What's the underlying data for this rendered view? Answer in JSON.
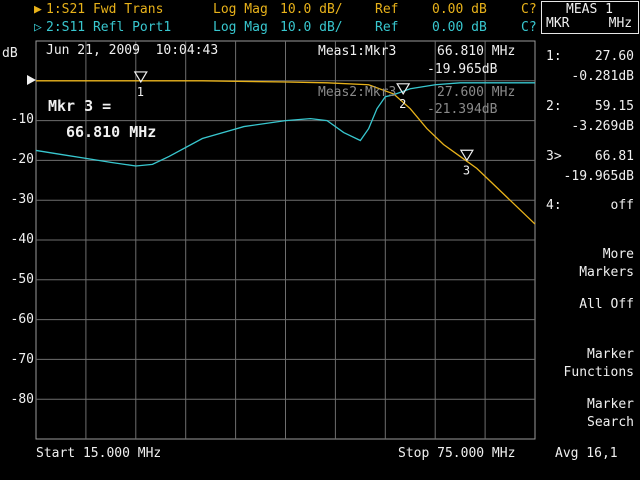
{
  "traces": [
    {
      "indicator": "▶",
      "label": "1:S21 Fwd Trans",
      "format": "Log Mag",
      "scale": "10.0 dB/",
      "ref_label": "Ref",
      "ref_value": "0.00 dB",
      "corr": "C?",
      "color": "#e8b21a"
    },
    {
      "indicator": "▷",
      "label": "2:S11 Refl Port1",
      "format": "Log Mag",
      "scale": "10.0 dB/",
      "ref_label": "Ref",
      "ref_value": "0.00 dB",
      "corr": "C?",
      "color": "#38c7cf"
    }
  ],
  "plot": {
    "unit": "dB",
    "timestamp": "Jun 21, 2009  10:04:43",
    "ytick_labels": [
      "-10",
      "-20",
      "-30",
      "-40",
      "-50",
      "-60",
      "-70",
      "-80"
    ],
    "start": "Start 15.000 MHz",
    "stop": "Stop 75.000 MHz",
    "avg": "Avg 16,1",
    "marker_callout_line1": "Mkr 3 =",
    "marker_callout_line2": "66.810 MHz",
    "meas1_label": "Meas1:Mkr3",
    "meas1_freq": "66.810 MHz",
    "meas1_val": "-19.965dB",
    "meas2_label": "Meas2:Mkr3",
    "meas2_freq": "27.600 MHz",
    "meas2_val": "-21.394dB",
    "marker_tags": [
      "1",
      "2",
      "3"
    ]
  },
  "chart_data": {
    "type": "line",
    "xlim": [
      15,
      75
    ],
    "ylim": [
      -90,
      10
    ],
    "series": [
      {
        "name": "1:S21 Fwd Trans",
        "color": "#e8b21a",
        "x": [
          15,
          25,
          35,
          45,
          50,
          55,
          58,
          60,
          62,
          64,
          66,
          68,
          70,
          72,
          75
        ],
        "y": [
          0,
          0,
          0,
          -0.3,
          -0.5,
          -1.0,
          -3.3,
          -7,
          -12,
          -16,
          -19,
          -22,
          -26,
          -30,
          -36
        ]
      },
      {
        "name": "2:S11 Refl Port1",
        "color": "#38c7cf",
        "x": [
          15,
          18,
          21,
          24,
          27,
          29,
          31,
          35,
          40,
          45,
          48,
          50,
          52,
          54,
          55,
          56,
          57,
          58,
          60,
          63,
          66,
          70,
          75
        ],
        "y": [
          -17.5,
          -18.5,
          -19.5,
          -20.5,
          -21.4,
          -21,
          -19,
          -14.5,
          -11.5,
          -10,
          -9.5,
          -10,
          -13,
          -15,
          -12,
          -7,
          -4,
          -3.5,
          -2,
          -1,
          -0.5,
          -0.5,
          -0.5
        ]
      }
    ],
    "markers": [
      {
        "id": "1",
        "x": 27.6,
        "y": -0.28
      },
      {
        "id": "2",
        "x": 59.15,
        "y": -3.27
      },
      {
        "id": "3",
        "x": 66.81,
        "y": -19.965
      }
    ]
  },
  "side_panel": {
    "title_line1": "MEAS 1",
    "title_line2": "MKR     MHz",
    "markers": [
      {
        "id": "1:",
        "freq": "27.60",
        "val": "-0.281dB"
      },
      {
        "id": "2:",
        "freq": "59.15",
        "val": "-3.269dB"
      },
      {
        "id": "3>",
        "freq": "66.81",
        "val": "-19.965dB"
      },
      {
        "id": "4:",
        "freq": "off",
        "val": ""
      }
    ],
    "softkeys": [
      {
        "line1": "More",
        "line2": "Markers"
      },
      {
        "line1": "All Off",
        "line2": ""
      },
      {
        "line1": "Marker",
        "line2": "Functions"
      },
      {
        "line1": "Marker",
        "line2": "Search"
      }
    ]
  }
}
